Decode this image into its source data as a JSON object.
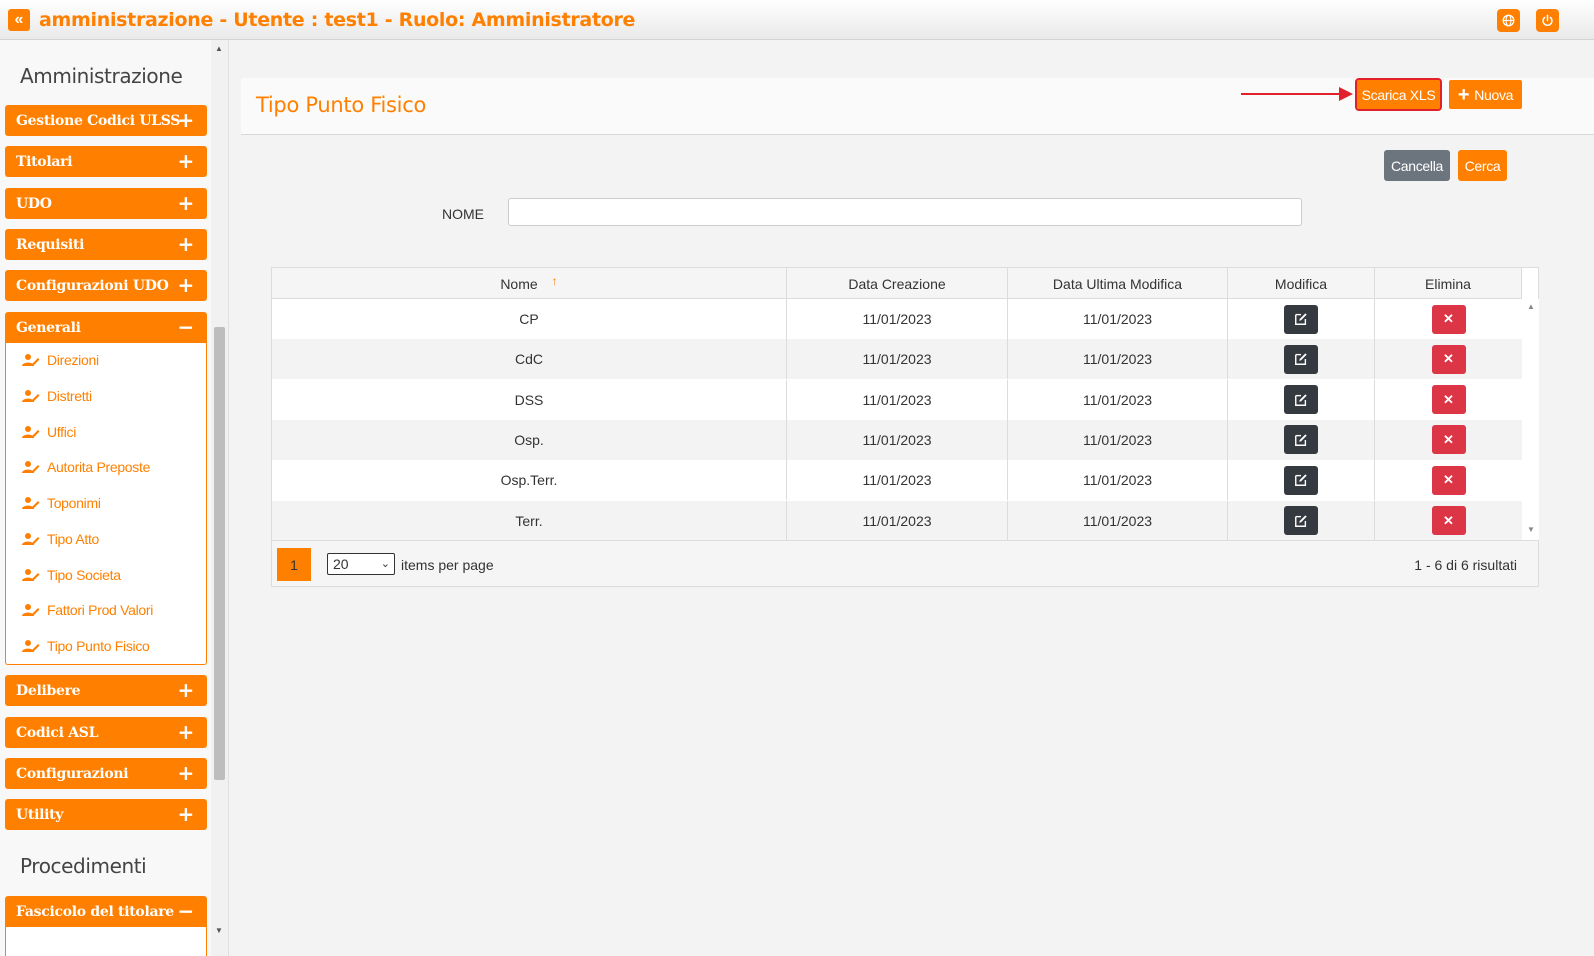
{
  "header": {
    "title": "amministrazione - Utente : test1 - Ruolo: Amministratore",
    "back_icon": "double-chevron-left-icon",
    "globe_icon": "globe-icon",
    "power_icon": "power-icon"
  },
  "sidebar": {
    "section1": "Amministrazione",
    "groups_top": [
      {
        "label": "Gestione Codici ULSS",
        "sign": "+"
      },
      {
        "label": "Titolari",
        "sign": "+"
      },
      {
        "label": "UDO",
        "sign": "+"
      },
      {
        "label": "Requisiti",
        "sign": "+"
      },
      {
        "label": "Configurazioni UDO",
        "sign": "+"
      },
      {
        "label": "Generali",
        "sign": "−"
      }
    ],
    "sub_items": [
      "Direzioni",
      "Distretti",
      "Uffici",
      "Autorita Preposte",
      "Toponimi",
      "Tipo Atto",
      "Tipo Societa",
      "Fattori Prod Valori",
      "Tipo Punto Fisico"
    ],
    "groups_bottom": [
      {
        "label": "Delibere",
        "sign": "+"
      },
      {
        "label": "Codici ASL",
        "sign": "+"
      },
      {
        "label": "Configurazioni",
        "sign": "+"
      },
      {
        "label": "Utility",
        "sign": "+"
      }
    ],
    "section2": "Procedimenti",
    "group_last": {
      "label": "Fascicolo del titolare",
      "sign": "−"
    }
  },
  "page": {
    "title": "Tipo Punto Fisico",
    "scarica_label": "Scarica XLS",
    "nuova_label": "Nuova",
    "nuova_sign": "+",
    "cancella_label": "Cancella",
    "cerca_label": "Cerca",
    "filter_label": "NOME",
    "filter_value": ""
  },
  "table": {
    "columns": [
      "Nome",
      "Data Creazione",
      "Data Ultima Modifica",
      "Modifica",
      "Elimina"
    ],
    "sort_indicator": "↑",
    "rows": [
      {
        "nome": "CP",
        "creazione": "11/01/2023",
        "modifica": "11/01/2023"
      },
      {
        "nome": "CdC",
        "creazione": "11/01/2023",
        "modifica": "11/01/2023"
      },
      {
        "nome": "DSS",
        "creazione": "11/01/2023",
        "modifica": "11/01/2023"
      },
      {
        "nome": "Osp.",
        "creazione": "11/01/2023",
        "modifica": "11/01/2023"
      },
      {
        "nome": "Osp.Terr.",
        "creazione": "11/01/2023",
        "modifica": "11/01/2023"
      },
      {
        "nome": "Terr.",
        "creazione": "11/01/2023",
        "modifica": "11/01/2023"
      }
    ],
    "delete_glyph": "✕"
  },
  "pager": {
    "current_page": "1",
    "page_size": "20",
    "items_per_page_label": "items per page",
    "results_label": "1 - 6 di 6 risultati"
  },
  "colors": {
    "accent": "#ff8000",
    "danger": "#dc3545",
    "dark": "#343a40",
    "gray": "#6c757d",
    "highlight": "#e0202a"
  }
}
